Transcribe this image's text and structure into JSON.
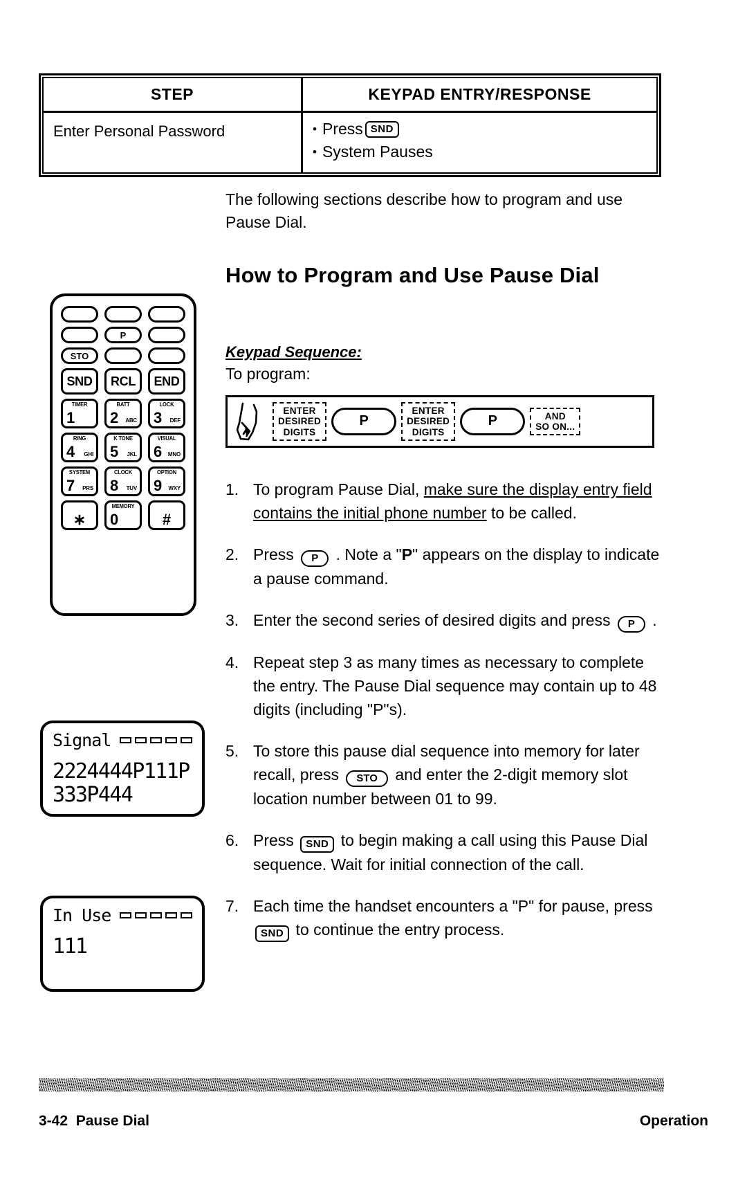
{
  "table": {
    "headers": [
      "STEP",
      "KEYPAD ENTRY/RESPONSE"
    ],
    "row": {
      "step": "Enter Personal Password",
      "responses": [
        {
          "pre": "Press",
          "key": "SND",
          "post": ""
        },
        {
          "pre": "System Pauses",
          "key": "",
          "post": ""
        }
      ]
    }
  },
  "intro": {
    "paragraph": "The following sections describe how to program and use Pause Dial."
  },
  "heading": "How to Program and Use Pause Dial",
  "keypad_sequence": {
    "label": "Keypad Sequence:",
    "sub": "To program:",
    "items": [
      {
        "type": "hand-icon",
        "text": ""
      },
      {
        "type": "dashed",
        "text": "ENTER\nDESIRED\nDIGITS"
      },
      {
        "type": "oval",
        "text": "P"
      },
      {
        "type": "dashed",
        "text": "ENTER\nDESIRED\nDIGITS"
      },
      {
        "type": "oval",
        "text": "P"
      },
      {
        "type": "dashed",
        "text": "AND\nSO ON..."
      }
    ]
  },
  "steps": [
    {
      "num": "1.",
      "parts": [
        {
          "t": "text",
          "v": "To program Pause Dial, "
        },
        {
          "t": "underline",
          "v": "make sure the display entry field contains the initial phone number"
        },
        {
          "t": "text",
          "v": " to be called."
        }
      ]
    },
    {
      "num": "2.",
      "parts": [
        {
          "t": "text",
          "v": "Press "
        },
        {
          "t": "oval-key",
          "v": "P"
        },
        {
          "t": "text",
          "v": " .  Note a \""
        },
        {
          "t": "bold",
          "v": "P"
        },
        {
          "t": "text",
          "v": "\" appears on the display to indicate a pause command."
        }
      ]
    },
    {
      "num": "3.",
      "parts": [
        {
          "t": "text",
          "v": "Enter the second series of desired digits and press "
        },
        {
          "t": "oval-key",
          "v": "P"
        },
        {
          "t": "text",
          "v": " ."
        }
      ]
    },
    {
      "num": "4.",
      "parts": [
        {
          "t": "text",
          "v": "Repeat step 3 as many times as necessary to complete the entry.  The Pause Dial sequence may contain up to 48 digits (including \"P\"s)."
        }
      ]
    },
    {
      "num": "5.",
      "parts": [
        {
          "t": "text",
          "v": "To store this pause dial sequence into memory for later recall, press "
        },
        {
          "t": "oval-key",
          "v": "STO"
        },
        {
          "t": "text",
          "v": " and enter the 2-digit memory slot location number between 01 to 99."
        }
      ]
    },
    {
      "num": "6.",
      "parts": [
        {
          "t": "text",
          "v": "Press "
        },
        {
          "t": "rect-key",
          "v": "SND"
        },
        {
          "t": "text",
          "v": " to begin making a call using this Pause Dial sequence.  Wait for initial connection of the call."
        }
      ]
    },
    {
      "num": "7.",
      "parts": [
        {
          "t": "text",
          "v": "Each time the handset encounters a \"P\" for pause, press "
        },
        {
          "t": "rect-key",
          "v": "SND"
        },
        {
          "t": "text",
          "v": " to continue the entry process."
        }
      ]
    }
  ],
  "handset": {
    "soft_rows": [
      [
        "",
        "",
        ""
      ],
      [
        "",
        "P",
        ""
      ],
      [
        "STO",
        "",
        ""
      ]
    ],
    "function_row": [
      "SND",
      "RCL",
      "END"
    ],
    "number_keys": [
      [
        {
          "top": "TIMER",
          "digit": "1",
          "letters": ""
        },
        {
          "top": "BATT",
          "digit": "2",
          "letters": "ABC"
        },
        {
          "top": "LOCK",
          "digit": "3",
          "letters": "DEF"
        }
      ],
      [
        {
          "top": "RING",
          "digit": "4",
          "letters": "GHI"
        },
        {
          "top": "K TONE",
          "digit": "5",
          "letters": "JKL"
        },
        {
          "top": "VISUAL",
          "digit": "6",
          "letters": "MNO"
        }
      ],
      [
        {
          "top": "SYSTEM",
          "digit": "7",
          "letters": "PRS"
        },
        {
          "top": "CLOCK",
          "digit": "8",
          "letters": "TUV"
        },
        {
          "top": "OPTION",
          "digit": "9",
          "letters": "WXY"
        }
      ],
      [
        {
          "top": "",
          "digit": "∗",
          "letters": ""
        },
        {
          "top": "MEMORY",
          "digit": "0",
          "letters": ""
        },
        {
          "top": "",
          "digit": "#",
          "letters": ""
        }
      ]
    ]
  },
  "displays": [
    {
      "name": "signal-display",
      "status": "Signal",
      "bars": 5,
      "lines": [
        "2224444P111P",
        "333P444"
      ]
    },
    {
      "name": "in-use-display",
      "status": "In Use",
      "bars": 5,
      "lines": [
        "111"
      ]
    }
  ],
  "footer": {
    "page": "3-42",
    "section": "Pause Dial",
    "chapter": "Operation"
  }
}
